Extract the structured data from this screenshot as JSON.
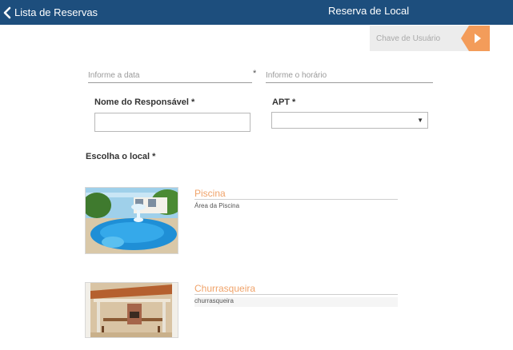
{
  "header": {
    "back_label": "Lista de Reservas",
    "title": "Reserva de Local",
    "back_icon": "chevron-left-icon",
    "background": "#1d4e7d"
  },
  "user_key": {
    "placeholder": "Chave de Usuário",
    "button_icon": "arrow-right-icon",
    "button_color": "#f39c5a"
  },
  "form": {
    "date_placeholder": "Informe a data",
    "date_required_mark": "*",
    "time_placeholder": "Informe o horário",
    "responsible_label": "Nome do Responsável *",
    "responsible_value": "",
    "apt_label": "APT *",
    "apt_selected": "",
    "local_label": "Escolha o local *"
  },
  "locais": [
    {
      "name": "Piscina",
      "description": "Área da Piscina",
      "image": "pool-photo"
    },
    {
      "name": "Churrasqueira",
      "description": "churrasqueira",
      "image": "barbecue-photo"
    }
  ],
  "accent_color": "#f0a36a"
}
